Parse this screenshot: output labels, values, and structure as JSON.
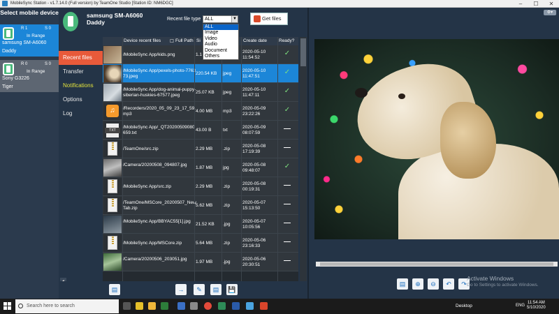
{
  "window": {
    "title": "MobileSync Station - v1.7.14.0 (Full version) by TeamOne Studio [Station ID: NM6DGC]",
    "controls": [
      "–",
      "☐",
      "✕"
    ]
  },
  "devices": {
    "header": "Select mobile device",
    "items": [
      {
        "r": "R 1",
        "s": "S 0",
        "status": "In Range",
        "name": "samsung SM-A6060",
        "owner": "Daddy",
        "active": true
      },
      {
        "r": "R 0",
        "s": "S 0",
        "status": "In Range",
        "name": "Sony G3226",
        "owner": "Tiger",
        "active": false
      }
    ]
  },
  "header": {
    "model": "samsung SM-A6060",
    "owner": "Daddy",
    "recent_file_type_label": "Recent file type",
    "selected_type": "ALL",
    "get_files": "Get files",
    "type_options": [
      "ALL",
      "Image",
      "Video",
      "Audio",
      "Document",
      "Others"
    ]
  },
  "nav": {
    "items": [
      "Recent files",
      "Transfer",
      "Notifications",
      "Options",
      "Log"
    ],
    "collapse": "◂"
  },
  "table": {
    "col_files": "Device recent files",
    "col_fullpath": "Full Path",
    "col_size": "Si",
    "col_date": "Create date",
    "col_ready": "Ready?",
    "rows": [
      {
        "thumb": "img",
        "path": "/MobileSync App/kids.png",
        "size": "1.1",
        "type": "",
        "date": "2020-05-10 11:54:52",
        "ready": "✓"
      },
      {
        "thumb": "dog",
        "path": "/MobileSync App/pexels-photo-776373.jpeg",
        "size": "220.54 KB",
        "type": "jpeg",
        "date": "2020-05-10 11:47:51",
        "ready": "✓"
      },
      {
        "thumb": "husky",
        "path": "/MobileSync App/dog-animal-puppy-siberian-huskies-67577.jpeg",
        "size": "25.07 KB",
        "type": "jpeg",
        "date": "2020-05-10 11:47:11",
        "ready": "✓"
      },
      {
        "thumb": "audio",
        "path": "/Recorders/2020_05_09_23_17_59.mp3",
        "size": "4.00 MB",
        "type": "mp3",
        "date": "2020-05-09 23:22:26",
        "ready": "✓"
      },
      {
        "thumb": "txt",
        "path": "/MobileSync App/_QT20200509080659.txt",
        "size": "43.00 B",
        "type": "txt",
        "date": "2020-05-09 08:07:59",
        "ready": "—"
      },
      {
        "thumb": "zip",
        "path": "/TeamOne/src.zip",
        "size": "2.29 MB",
        "type": ".zip",
        "date": "2020-05-08 17:19:39",
        "ready": "—"
      },
      {
        "thumb": "cam",
        "path": "/Camera/20200508_094807.jpg",
        "size": "1.87 MB",
        "type": "jpg",
        "date": "2020-05-08 09:48:07",
        "ready": "✓"
      },
      {
        "thumb": "zip",
        "path": "/MobileSync App/src.zip",
        "size": "2.29 MB",
        "type": ".zip",
        "date": "2020-05-08 00:19:31",
        "ready": "—"
      },
      {
        "thumb": "zip",
        "path": "/TeamOne/MSCore_20200507_NewTab.zip",
        "size": "5.62 MB",
        "type": ".zip",
        "date": "2020-05-07 15:13:50",
        "ready": "—"
      },
      {
        "thumb": "dark",
        "path": "/MobileSync App/BBYAC55[1].jpg",
        "size": "21.52 KB",
        "type": ".jpg",
        "date": "2020-05-07 10:05:56",
        "ready": "—"
      },
      {
        "thumb": "zip",
        "path": "/MobileSync App/MSCore.zip",
        "size": "5.64 MB",
        "type": ".zip",
        "date": "2020-05-06 23:16:33",
        "ready": "—"
      },
      {
        "thumb": "green",
        "path": "/Camera/20200506_203051.jpg",
        "size": "1.97 MB",
        "type": ".jpg",
        "date": "2020-05-06 20:30:51",
        "ready": "—"
      }
    ]
  },
  "toolbar_left": [
    "→",
    "✎",
    "▤",
    "💾"
  ],
  "toolbar_right": [
    "▤",
    "⊕",
    "⊖",
    "↶",
    "↷"
  ],
  "watermark": {
    "line1": "Activate Windows",
    "line2": "Go to Settings to activate Windows."
  },
  "taskbar": {
    "search_placeholder": "Search here to search",
    "desktop": "Desktop",
    "lang": "ENG",
    "time": "11:54 AM",
    "date": "5/10/2020"
  }
}
